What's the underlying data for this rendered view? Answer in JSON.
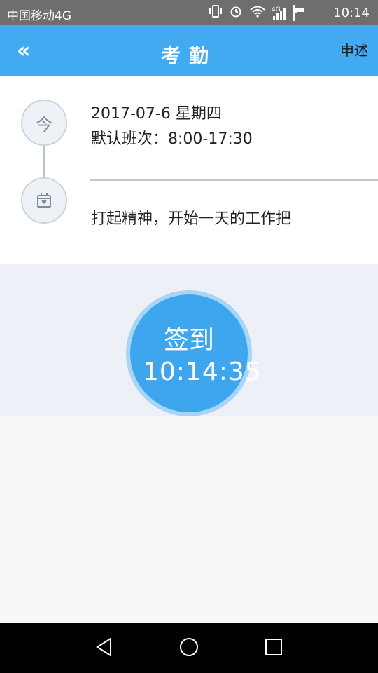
{
  "status": {
    "carrier": "中国移动4G",
    "network_badge": "4G",
    "time": "10:14",
    "icons": [
      "vibrate-icon",
      "alarm-icon",
      "wifi-icon",
      "signal-icon",
      "battery-icon"
    ]
  },
  "header": {
    "back_label": "«",
    "title": "考勤",
    "action_label": "申述",
    "bg_color": "#41aaf0"
  },
  "info": {
    "today_badge": "今",
    "date": "2017-07-6 星期四",
    "shift": "默认班次：8:00-17:30",
    "motto": "打起精神，开始一天的工作把"
  },
  "sign": {
    "label": "签到",
    "clock": "10:14:35",
    "button_color": "#3ea6ee"
  },
  "navbar": {
    "icons": [
      "back-icon",
      "home-icon",
      "recent-apps-icon"
    ]
  }
}
